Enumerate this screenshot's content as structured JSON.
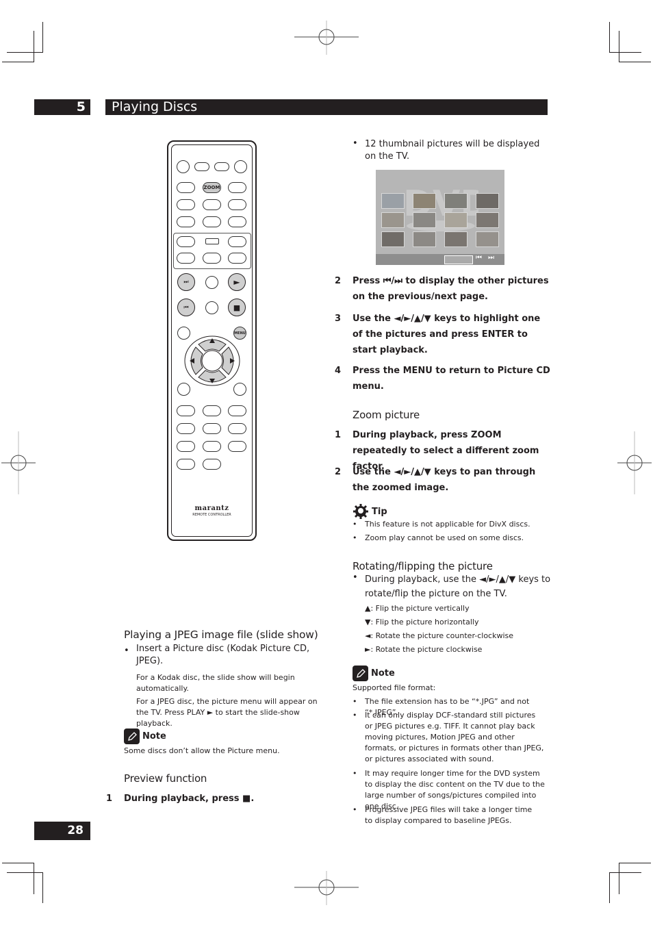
{
  "header": {
    "chapter_number": "5",
    "chapter_title": "Playing Discs"
  },
  "page_number": "28",
  "remote": {
    "zoom_button": "ZOOM",
    "menu_button": "MENU",
    "next_button_icon": "next-track-icon",
    "play_button_icon": "play-icon",
    "prev_button_icon": "previous-track-icon",
    "stop_button_icon": "stop-icon",
    "brand": "marantz",
    "subtitle": "REMOTE CONTROLLER"
  },
  "left_column": {
    "slideshow": {
      "heading": "Playing a JPEG image file (slide show)",
      "bullet": "Insert a Picture disc (Kodak Picture CD, JPEG).",
      "para1": "For a Kodak disc, the slide show will begin automatically.",
      "para2": "For a JPEG disc, the picture menu will appear on the TV. Press PLAY ► to start the slide-show playback."
    },
    "note": {
      "label": "Note",
      "text": "Some discs don’t allow the Picture menu."
    },
    "preview": {
      "heading": "Preview function",
      "steps": [
        {
          "num": "1",
          "text": "During playback, press ■."
        }
      ]
    }
  },
  "right_column": {
    "thumbnail_bullet": "12 thumbnail pictures will be displayed on the TV.",
    "thumbnail_screen": {
      "thumbnail_count": 12,
      "bar_icons": [
        "previous-track-icon",
        "next-track-icon"
      ]
    },
    "preview_steps": [
      {
        "num": "2",
        "text": "Press ⏮/⏭ to display the other pictures on the previous/next page."
      },
      {
        "num": "3",
        "text": "Use the ◄/►/▲/▼ keys to highlight one of the pictures and press ENTER to start playback."
      },
      {
        "num": "4",
        "text": "Press the MENU to return to Picture CD menu."
      }
    ],
    "zoom": {
      "heading": "Zoom picture",
      "steps": [
        {
          "num": "1",
          "text": "During playback, press ZOOM repeatedly to select a different zoom factor."
        },
        {
          "num": "2",
          "text": "Use the ◄/►/▲/▼ keys to pan through the zoomed image."
        }
      ]
    },
    "tip": {
      "label": "Tip",
      "items": [
        "This feature is not applicable for DivX discs.",
        "Zoom play cannot be used on some discs."
      ]
    },
    "rotate": {
      "heading": "Rotating/flipping the picture",
      "bullet": "During playback, use the ◄/►/▲/▼ keys to rotate/flip the picture on the TV.",
      "items": [
        "▲: Flip the picture vertically",
        "▼: Flip the picture horizontally",
        "◄: Rotate the picture counter-clockwise",
        "►: Rotate the picture clockwise"
      ]
    },
    "note": {
      "label": "Note",
      "intro": "Supported file format:",
      "items": [
        "The file extension has to be “*.JPG” and not “*.JPEG”.",
        "It can only display DCF-standard still pictures or JPEG pictures e.g. TIFF. It cannot play back moving pictures, Motion JPEG and other formats, or pictures in formats other than JPEG, or pictures associated with sound.",
        "It may require longer time for the DVD system to display the disc content on the TV due to the large number of songs/pictures compiled into one disc.",
        "Progressive JPEG files will take a longer time to display compared to baseline JPEGs."
      ]
    }
  }
}
